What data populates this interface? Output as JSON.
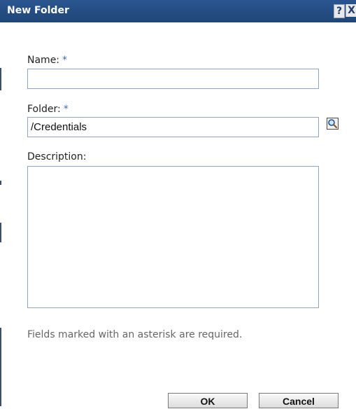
{
  "window": {
    "title": "New Folder",
    "help_label": "?",
    "close_label": "X"
  },
  "form": {
    "name_label": "Name:",
    "folder_label": "Folder:",
    "required_marker": "*",
    "name_value": "",
    "folder_value": "/Credentials",
    "description_label": "Description:",
    "description_value": ""
  },
  "icons": {
    "folder_browse": "search-icon"
  },
  "footer": {
    "hint": "Fields marked with an asterisk are required.",
    "ok_label": "OK",
    "cancel_label": "Cancel"
  },
  "colors": {
    "titlebar": "#1f4678",
    "field_border": "#8fa6c2"
  }
}
